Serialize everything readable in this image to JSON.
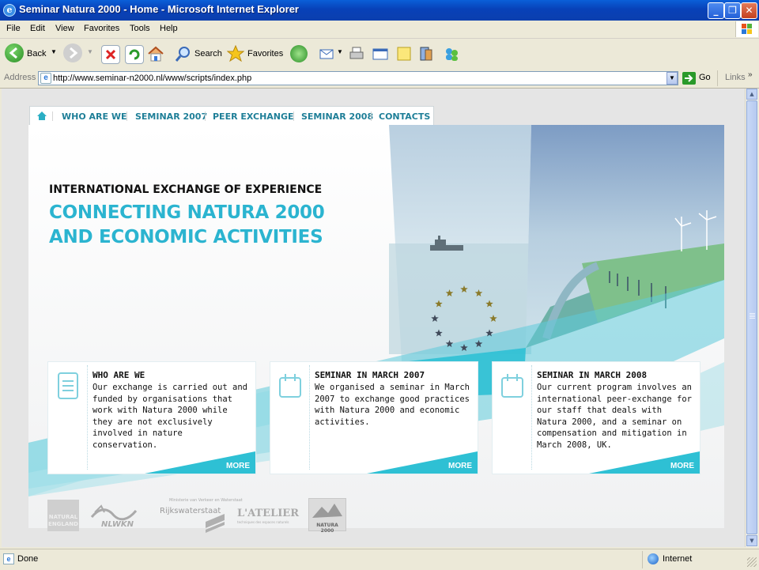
{
  "window": {
    "title": "Seminar Natura 2000 - Home - Microsoft Internet Explorer"
  },
  "menu": {
    "items": [
      "File",
      "Edit",
      "View",
      "Favorites",
      "Tools",
      "Help"
    ]
  },
  "toolbar": {
    "back_label": "Back",
    "search_label": "Search",
    "favorites_label": "Favorites"
  },
  "address": {
    "label": "Address",
    "url": "http://www.seminar-n2000.nl/www/scripts/index.php",
    "go_label": "Go",
    "links_label": "Links"
  },
  "site": {
    "nav": [
      "WHO ARE WE",
      "SEMINAR 2007",
      "PEER EXCHANGE",
      "SEMINAR 2008",
      "CONTACTS"
    ],
    "kicker": "INTERNATIONAL EXCHANGE OF EXPERIENCE",
    "headline1": "CONNECTING NATURA 2000",
    "headline2": "AND ECONOMIC ACTIVITIES",
    "cards": [
      {
        "title": "WHO ARE WE",
        "body": "Our exchange is carried out and funded by organisations that work with Natura 2000 while they are not exclusively involved in nature conservation.",
        "more": "MORE"
      },
      {
        "title": "SEMINAR IN MARCH 2007",
        "body": "We organised a seminar in March 2007 to exchange good practices with Natura 2000 and economic activities.",
        "more": "MORE"
      },
      {
        "title": "SEMINAR IN MARCH 2008",
        "body": "Our current program involves an international peer-exchange for our staff that deals with Natura 2000, and a seminar on compensation and mitigation in March 2008, UK.",
        "more": "MORE"
      }
    ],
    "logos": {
      "natural_england": [
        "NATURAL",
        "ENGLAND"
      ],
      "nlwkn": "NLWKN",
      "rws_top": "Ministerie van Verkeer en Waterstaat",
      "rws": "Rijkswaterstaat",
      "atelier": "L'ATELIER",
      "atelier_sub": "techniques des espaces naturels",
      "natura": "NATURA 2000"
    }
  },
  "status": {
    "left": "Done",
    "zone": "Internet"
  },
  "colors": {
    "accent": "#29b8cc",
    "nav_text": "#1f7f98",
    "xp_blue": "#0a5fd8"
  }
}
